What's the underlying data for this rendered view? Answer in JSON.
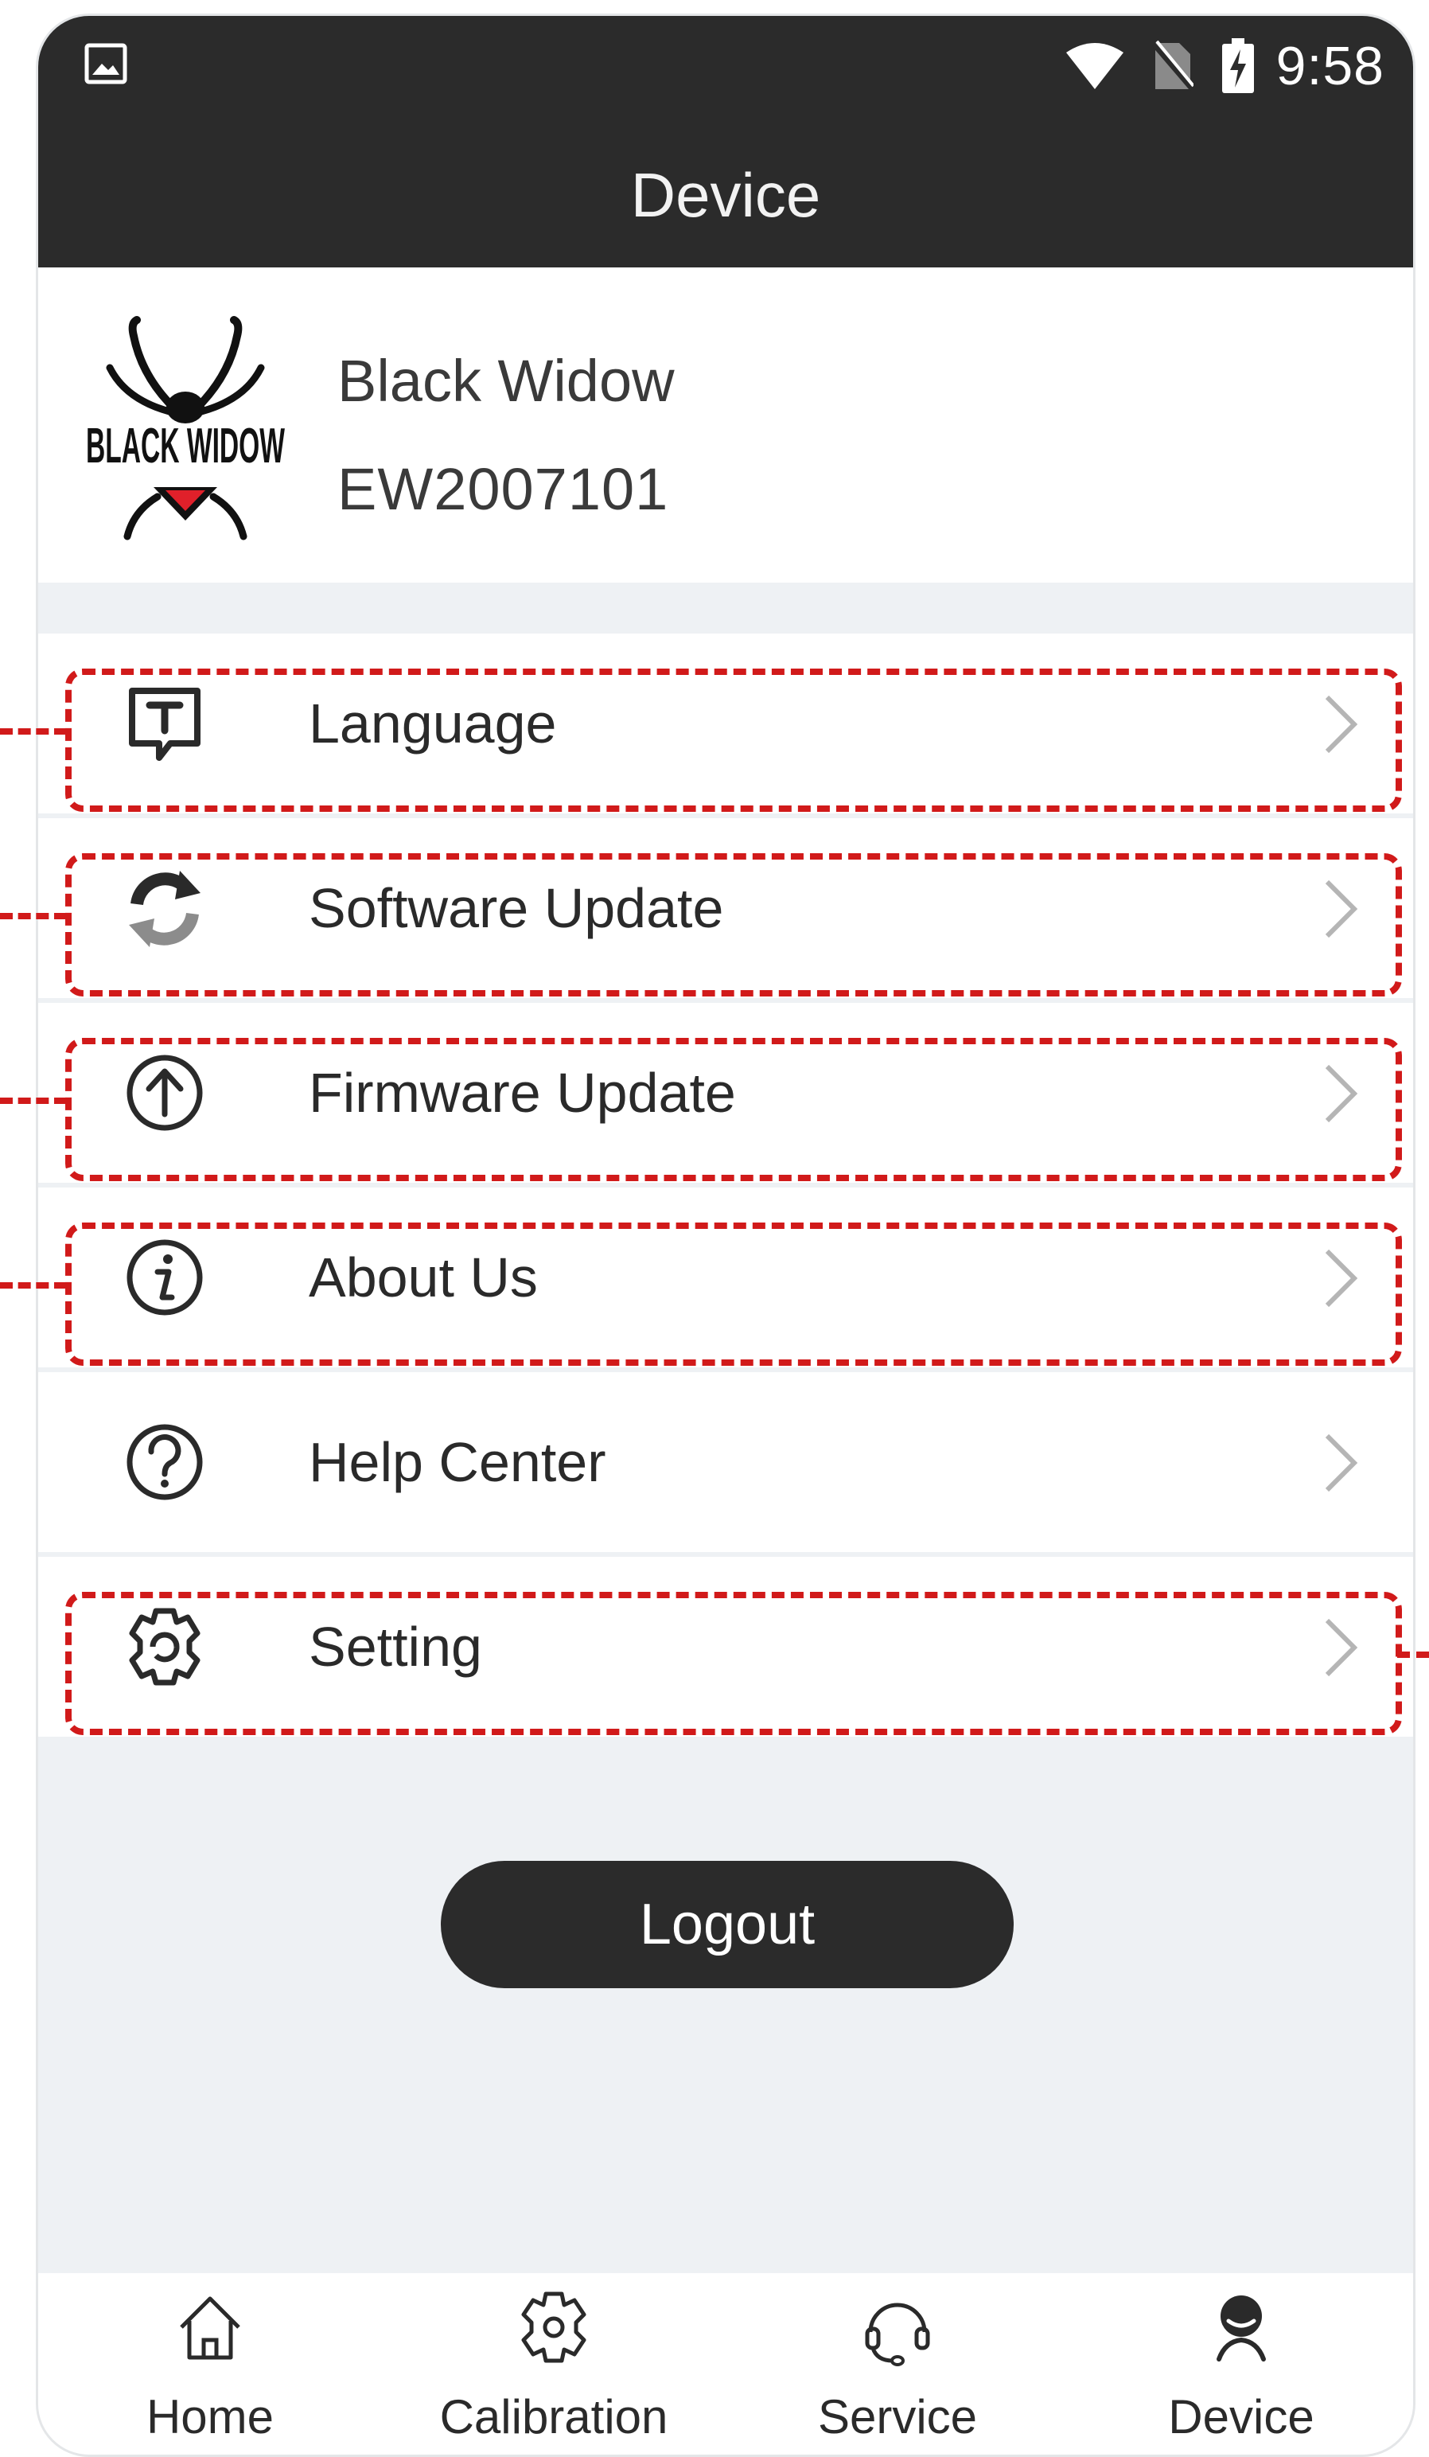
{
  "status_bar": {
    "time": "9:58",
    "icons": [
      "image-icon",
      "wifi-icon",
      "no-sim-icon",
      "battery-charging-icon"
    ]
  },
  "app_bar": {
    "title": "Device"
  },
  "profile": {
    "name": "Black Widow",
    "serial": "EW2007101",
    "logo_text": "BLACK WIDOW"
  },
  "menu": {
    "items": [
      {
        "label": "Language",
        "icon": "language-icon",
        "highlighted": true
      },
      {
        "label": "Software Update",
        "icon": "refresh-icon",
        "highlighted": true
      },
      {
        "label": "Firmware Update",
        "icon": "upload-icon",
        "highlighted": true
      },
      {
        "label": "About Us",
        "icon": "info-icon",
        "highlighted": true
      },
      {
        "label": "Help Center",
        "icon": "help-icon",
        "highlighted": false
      },
      {
        "label": "Setting",
        "icon": "gear-icon",
        "highlighted": true
      }
    ]
  },
  "logout": {
    "label": "Logout"
  },
  "tab_bar": {
    "tabs": [
      {
        "label": "Home",
        "icon": "home-icon",
        "active": false
      },
      {
        "label": "Calibration",
        "icon": "calibration-gear-icon",
        "active": false
      },
      {
        "label": "Service",
        "icon": "headset-icon",
        "active": false
      },
      {
        "label": "Device",
        "icon": "user-icon",
        "active": true
      }
    ]
  },
  "colors": {
    "header": "#2b2b2b",
    "highlight": "#d11a1a",
    "background": "#eef1f4",
    "accent_red": "#e0202a"
  }
}
